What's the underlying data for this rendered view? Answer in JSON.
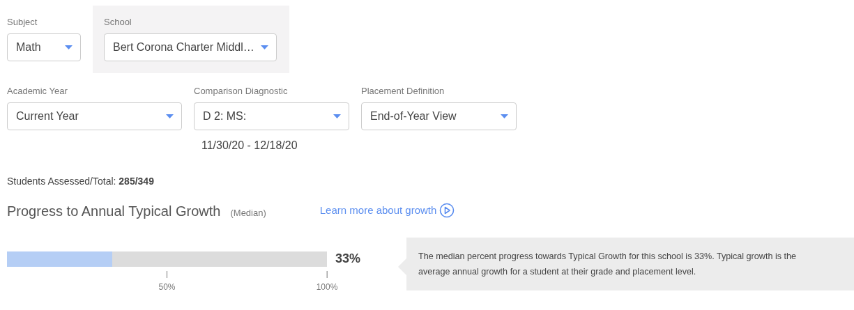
{
  "filters_top": [
    {
      "label": "Subject",
      "value": "Math",
      "highlighted": false
    },
    {
      "label": "School",
      "value": "Bert Corona Charter Middl…",
      "highlighted": true
    }
  ],
  "filters": [
    {
      "label": "Academic Year",
      "value": "Current Year"
    },
    {
      "label": "Comparison Diagnostic",
      "value": "D 2: MS:",
      "note": "11/30/20 - 12/18/20"
    },
    {
      "label": "Placement Definition",
      "value": "End-of-Year View"
    }
  ],
  "students": "Students Assessed/Total: **285/349**",
  "growth": {
    "title": "Progress to Annual Typical Growth",
    "qualifier": "(Median)",
    "link": "Learn more about growth",
    "level": 0.33,
    "reading": "33%",
    "ticks": [
      "50%",
      "100%"
    ],
    "tooltip": "The median percent progress towards Typical Growth for this school is 33%. Typical growth is the average annual growth for a student at their grade and placement level."
  }
}
